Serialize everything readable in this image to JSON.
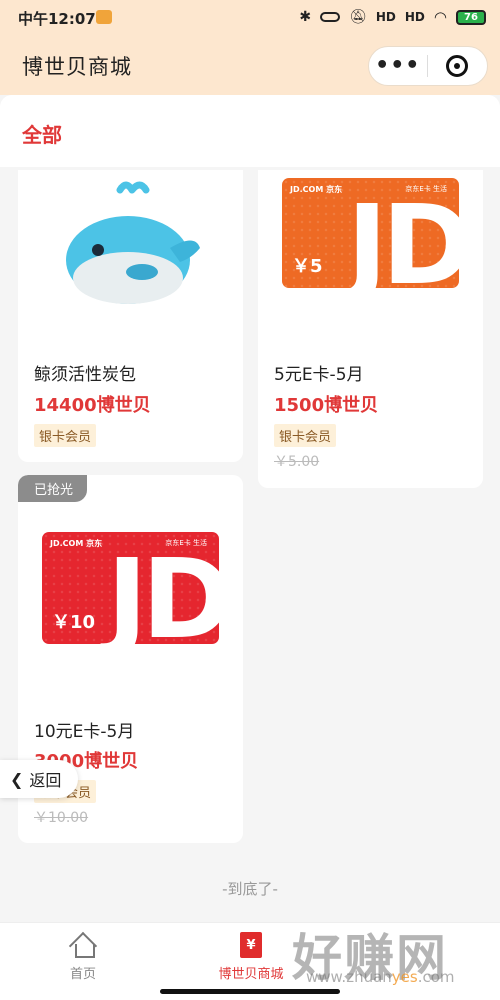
{
  "status_bar": {
    "time": "中午12:07",
    "signal1": "HD",
    "signal2": "HD",
    "battery": "76"
  },
  "header": {
    "title": "博世贝商城",
    "more_label": "•••"
  },
  "category": {
    "active": "全部"
  },
  "products": [
    {
      "name": "鲸须活性炭包",
      "price": "14400博世贝",
      "tag": "银卡会员",
      "icon": "whale-plush-image"
    },
    {
      "name": "5元E卡-5月",
      "price": "1500博世贝",
      "tag": "银卡会员",
      "old_price": "￥5.00",
      "card": {
        "brand": "JD.COM 京东",
        "brand2": "京东E卡 生活",
        "amount": "￥5",
        "logo": "JD",
        "color": "#ee6a24"
      }
    },
    {
      "name": "10元E卡-5月",
      "price": "3000博世贝",
      "tag": "银卡会员",
      "old_price": "￥10.00",
      "badge": "已抢光",
      "card": {
        "brand": "JD.COM 京东",
        "brand2": "京东E卡 生活",
        "amount": "￥10",
        "logo": "JD",
        "color": "#e5262f"
      }
    }
  ],
  "back_button": "返回",
  "bottom_note": "-到底了-",
  "tabbar": {
    "items": [
      {
        "label": "首页",
        "icon": "home-icon"
      },
      {
        "label": "博世贝商城",
        "icon": "mall-icon",
        "glyph": "¥",
        "active": true
      }
    ]
  },
  "watermark": {
    "text": "好赚网",
    "url_a": "www.zhuan",
    "url_b": "yes",
    "url_c": ".com"
  },
  "colors": {
    "accent": "#e03838",
    "header_bg": "#fde7cf",
    "tag_bg": "#fdf0d9"
  }
}
